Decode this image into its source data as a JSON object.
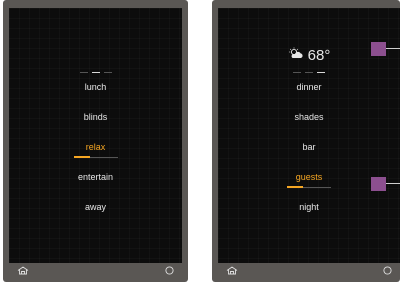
{
  "left_panel": {
    "items": [
      {
        "label": "lunch",
        "selected": false
      },
      {
        "label": "blinds",
        "selected": false
      },
      {
        "label": "relax",
        "selected": true
      },
      {
        "label": "entertain",
        "selected": false
      },
      {
        "label": "away",
        "selected": false
      }
    ]
  },
  "right_panel": {
    "weather": {
      "temperature": "68°",
      "icon": "partly-cloudy-icon"
    },
    "items": [
      {
        "label": "dinner",
        "selected": false
      },
      {
        "label": "shades",
        "selected": false
      },
      {
        "label": "bar",
        "selected": false
      },
      {
        "label": "guests",
        "selected": true
      },
      {
        "label": "night",
        "selected": false
      }
    ]
  },
  "footer": {
    "home_icon": "home-icon",
    "power_icon": "circle-icon"
  },
  "colors": {
    "accent": "#f5a623",
    "screen": "#0c0c0c",
    "bezel": "#5a5754",
    "annotation": "#8c4f8f"
  }
}
